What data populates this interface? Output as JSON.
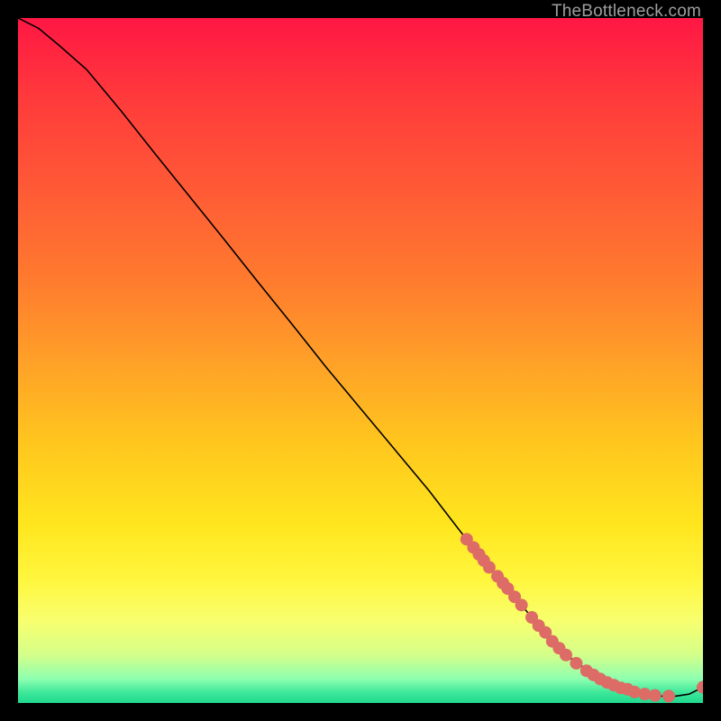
{
  "watermark": "TheBottleneck.com",
  "chart_data": {
    "type": "line",
    "xlim": [
      0,
      100
    ],
    "ylim": [
      0,
      100
    ],
    "title": "",
    "xlabel": "",
    "ylabel": "",
    "series": [
      {
        "name": "curve",
        "x": [
          0,
          3,
          6,
          10,
          15,
          20,
          25,
          30,
          35,
          40,
          45,
          50,
          55,
          60,
          65,
          70,
          75,
          80,
          85,
          88,
          90,
          92,
          94,
          96,
          98,
          100
        ],
        "y": [
          100,
          98.5,
          96,
          92.5,
          86.5,
          80.2,
          74,
          67.8,
          61.5,
          55.3,
          49,
          43,
          37,
          31,
          24.5,
          18.5,
          12.5,
          7,
          3.5,
          2.2,
          1.6,
          1.2,
          1.0,
          1.0,
          1.3,
          2.3
        ]
      }
    ],
    "points": {
      "name": "dots",
      "color": "#dd6b66",
      "x": [
        65.5,
        66.5,
        67.3,
        68.0,
        68.8,
        70.0,
        70.8,
        71.5,
        72.5,
        73.5,
        75.0,
        76.0,
        77.0,
        78.0,
        79.0,
        80.0,
        81.5,
        83.0,
        84.0,
        85.0,
        86.0,
        87.0,
        88.0,
        89.0,
        90.0,
        91.5,
        93.0,
        95.0,
        100.0
      ],
      "y": [
        23.9,
        22.7,
        21.7,
        20.8,
        19.8,
        18.5,
        17.5,
        16.7,
        15.5,
        14.3,
        12.5,
        11.3,
        10.3,
        9.0,
        8.0,
        7.0,
        5.8,
        4.7,
        4.1,
        3.5,
        3.0,
        2.6,
        2.2,
        2.0,
        1.6,
        1.3,
        1.1,
        1.0,
        2.3
      ]
    },
    "gradient_stops": [
      {
        "offset": 0.0,
        "color": "#ff1744"
      },
      {
        "offset": 0.12,
        "color": "#ff3b3b"
      },
      {
        "offset": 0.25,
        "color": "#ff5a36"
      },
      {
        "offset": 0.38,
        "color": "#ff7a2e"
      },
      {
        "offset": 0.5,
        "color": "#ffa028"
      },
      {
        "offset": 0.62,
        "color": "#ffc61e"
      },
      {
        "offset": 0.74,
        "color": "#ffe61e"
      },
      {
        "offset": 0.82,
        "color": "#fff63e"
      },
      {
        "offset": 0.88,
        "color": "#f8ff6e"
      },
      {
        "offset": 0.93,
        "color": "#d4ff8a"
      },
      {
        "offset": 0.965,
        "color": "#8effb0"
      },
      {
        "offset": 0.985,
        "color": "#3de79a"
      },
      {
        "offset": 1.0,
        "color": "#1fd98e"
      }
    ]
  }
}
